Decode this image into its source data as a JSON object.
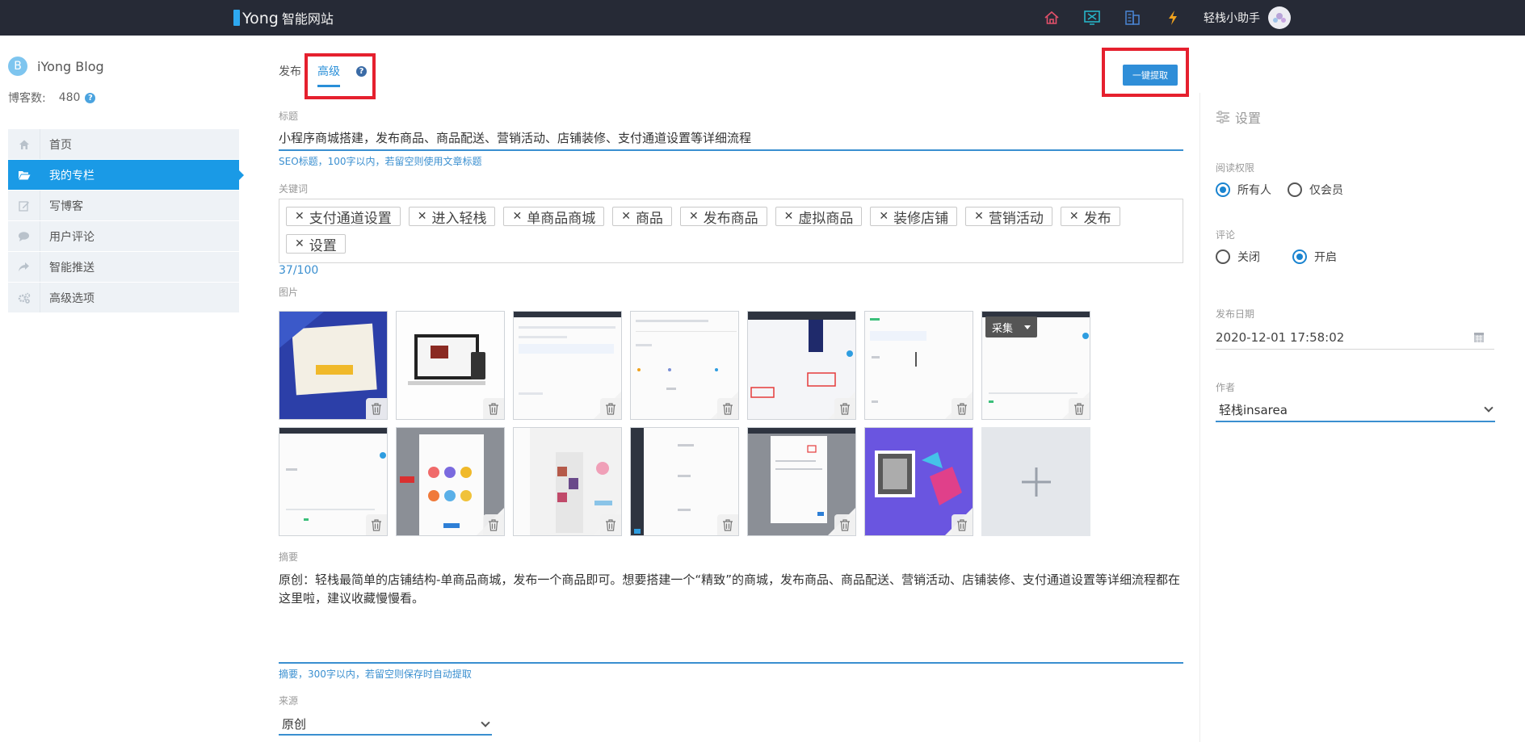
{
  "header": {
    "brand_prefix": "i",
    "brand_name": "Yong",
    "brand_cn": "智能网站",
    "icons": [
      "home-icon",
      "desktop-icon",
      "building-icon",
      "lightning-icon"
    ],
    "helper_name": "轻栈小助手"
  },
  "sidebar": {
    "blog_initial": "B",
    "blog_name": "iYong Blog",
    "count_label": "博客数:",
    "count_value": "480",
    "items": [
      {
        "label": "首页",
        "icon": "home-icon",
        "active": false
      },
      {
        "label": "我的专栏",
        "icon": "folder-open-icon",
        "active": true
      },
      {
        "label": "写博客",
        "icon": "edit-icon",
        "active": false
      },
      {
        "label": "用户评论",
        "icon": "comment-icon",
        "active": false
      },
      {
        "label": "智能推送",
        "icon": "share-icon",
        "active": false
      },
      {
        "label": "高级选项",
        "icon": "gears-icon",
        "active": false
      }
    ]
  },
  "tabs": {
    "publish": "发布",
    "advanced": "高级",
    "help": "?"
  },
  "toolbar": {
    "extract_label": "一键提取"
  },
  "form": {
    "title_label": "标题",
    "title_value": "小程序商城搭建，发布商品、商品配送、营销活动、店铺装修、支付通道设置等详细流程",
    "title_hint": "SEO标题，100字以内，若留空则使用文章标题",
    "keywords_label": "关键词",
    "keywords": [
      "支付通道设置",
      "进入轻栈",
      "单商品商城",
      "商品",
      "发布商品",
      "虚拟商品",
      "装修店铺",
      "营销活动",
      "发布",
      "设置"
    ],
    "keywords_count": "37/100",
    "images_label": "图片",
    "collect_label": "采集",
    "summary_label": "摘要",
    "summary_value": "原创：轻栈最简单的店铺结构-单商品商城，发布一个商品即可。想要搭建一个“精致”的商城，发布商品、商品配送、营销活动、店铺装修、支付通道设置等详细流程都在这里啦，建议收藏慢慢看。",
    "summary_hint": "摘要，300字以内，若留空则保存时自动提取",
    "source_label": "来源",
    "source_value": "原创"
  },
  "settings": {
    "heading": "设置",
    "read_label": "阅读权限",
    "read_options": [
      "所有人",
      "仅会员"
    ],
    "read_selected": "所有人",
    "comment_label": "评论",
    "comment_options": [
      "关闭",
      "开启"
    ],
    "comment_selected": "开启",
    "date_label": "发布日期",
    "date_value": "2020-12-01 17:58:02",
    "author_label": "作者",
    "author_value": "轻栈insarea"
  },
  "colors": {
    "header_bg": "#262a36",
    "accent": "#1a9ae6",
    "highlight_box": "#e5202e"
  }
}
